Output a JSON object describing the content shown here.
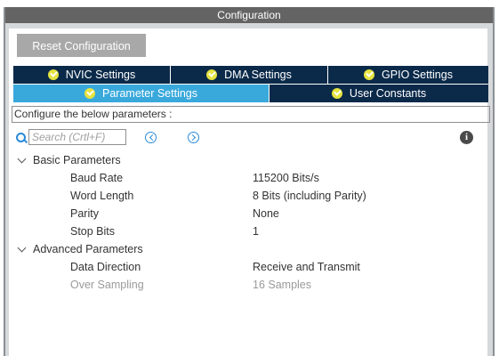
{
  "window": {
    "title": "Configuration"
  },
  "toolbar": {
    "reset_label": "Reset Configuration"
  },
  "tabs_row1": [
    {
      "label": "NVIC Settings"
    },
    {
      "label": "DMA Settings"
    },
    {
      "label": "GPIO Settings"
    }
  ],
  "tabs_row2": [
    {
      "label": "Parameter Settings",
      "active": true
    },
    {
      "label": "User Constants"
    }
  ],
  "description": "Configure the below parameters :",
  "search": {
    "placeholder": "Search (Crtl+F)",
    "value": ""
  },
  "groups": [
    {
      "label": "Basic Parameters",
      "params": [
        {
          "name": "Baud Rate",
          "value": "115200 Bits/s"
        },
        {
          "name": "Word Length",
          "value": "8 Bits (including Parity)"
        },
        {
          "name": "Parity",
          "value": "None"
        },
        {
          "name": "Stop Bits",
          "value": "1"
        }
      ]
    },
    {
      "label": "Advanced Parameters",
      "params": [
        {
          "name": "Data Direction",
          "value": "Receive and Transmit"
        },
        {
          "name": "Over Sampling",
          "value": "16 Samples",
          "disabled": true
        }
      ]
    }
  ],
  "colors": {
    "titlebar": "#646464",
    "tab_dark": "#0b2a4a",
    "tab_active": "#39a9dc",
    "check": "#e6e43f",
    "accent": "#2a8ad8"
  }
}
